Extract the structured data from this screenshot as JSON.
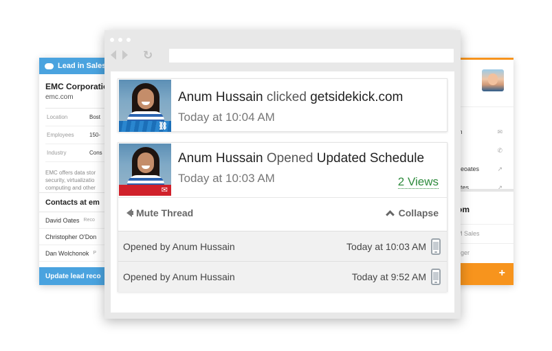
{
  "left_card": {
    "header": "Lead in Salesf",
    "company": "EMC Corporatio",
    "domain": "emc.com",
    "fields": [
      {
        "key": "Location",
        "value": "Bost"
      },
      {
        "key": "Employees",
        "value": "150-"
      },
      {
        "key": "Industry",
        "value": "Cons"
      }
    ],
    "description_lines": [
      "EMC offers data stor",
      "security, virtualizatio",
      "computing and other"
    ],
    "contacts_title": "Contacts at em",
    "contacts": [
      {
        "name": "David Oates",
        "role": "Reco"
      },
      {
        "name": "Christopher O'Don",
        "role": ""
      },
      {
        "name": "Dan Wolchonok",
        "role": "P"
      }
    ],
    "footer": "Update lead reco"
  },
  "right_card": {
    "rows": [
      {
        "text": "m",
        "icon": "✉"
      },
      {
        "text": "",
        "icon": "✆"
      },
      {
        "text": "deoates",
        "icon": "↗"
      },
      {
        "text": "ates",
        "icon": "↗"
      }
    ],
    "section_title": "om",
    "sub_rows": [
      "M Sales",
      "ager"
    ],
    "plus": "+"
  },
  "notifications": [
    {
      "name": "Anum Hussain",
      "verb": "clicked",
      "target": "getsidekick.com",
      "time": "Today at 10:04 AM",
      "band_icon": "link-icon"
    },
    {
      "name": "Anum Hussain",
      "verb": "Opened",
      "target": "Updated Schedule",
      "time": "Today at 10:03 AM",
      "views": "2 Views",
      "band_icon": "envelope-icon",
      "mute_label": "Mute Thread",
      "collapse_label": "Collapse",
      "opens": [
        {
          "label": "Opened by Anum Hussain",
          "time": "Today at 10:03 AM"
        },
        {
          "label": "Opened by Anum Hussain",
          "time": "Today at 9:52 AM"
        }
      ]
    }
  ],
  "colors": {
    "salesforce_blue": "#4aa3df",
    "orange": "#f7941d",
    "views_green": "#2e8b3d",
    "email_red": "#d0212b",
    "link_blue": "#1b6fb8"
  }
}
